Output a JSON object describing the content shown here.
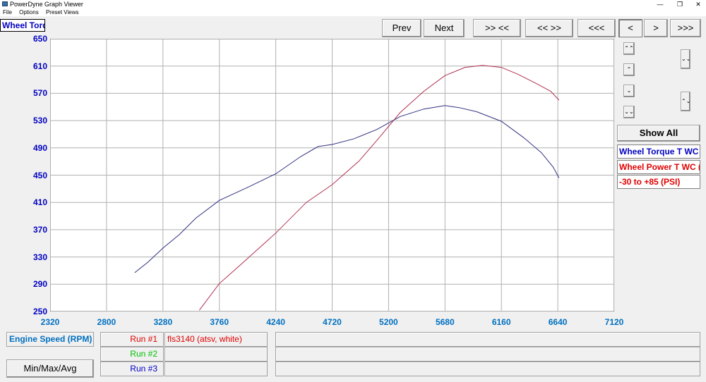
{
  "window": {
    "title": "PowerDyne Graph Viewer",
    "minimize_glyph": "—",
    "restore_glyph": "❐",
    "close_glyph": "✕"
  },
  "menu": {
    "items": [
      "File",
      "Options",
      "Preset Views"
    ]
  },
  "toolbar": {
    "prev": "Prev",
    "next": "Next",
    "zoom_in": ">> <<",
    "zoom_out": "<< >>",
    "nav_first": "<<<",
    "nav_prev": "<",
    "nav_next": ">",
    "nav_last": ">>>"
  },
  "side": {
    "show_all": "Show All",
    "small_buttons": [
      "⌃⌃",
      "⌃",
      "⌄",
      "⌄⌄",
      "⌄⌄",
      "⌃⌄"
    ]
  },
  "axis": {
    "y_title": "Wheel Torq",
    "x_title": "Engine Speed (RPM)"
  },
  "legend": [
    {
      "label": "Wheel Torque T WC",
      "color": "#0000c0"
    },
    {
      "label": "Wheel Power T WC (",
      "color": "#e00000"
    },
    {
      "label": "-30 to +85 (PSI)",
      "color": "#e00000"
    }
  ],
  "runs": [
    {
      "label": "Run #1",
      "color": "#e00000",
      "name": "fls3140 (atsv, white)"
    },
    {
      "label": "Run #2",
      "color": "#00c000",
      "name": ""
    },
    {
      "label": "Run #3",
      "color": "#0000c0",
      "name": ""
    }
  ],
  "footer": {
    "minmax": "Min/Max/Avg"
  },
  "chart_data": {
    "type": "line",
    "xlabel": "Engine Speed (RPM)",
    "ylabel": "Wheel Torq",
    "xlim": [
      2320,
      7120
    ],
    "ylim": [
      250,
      650
    ],
    "x_ticks": [
      2320,
      2800,
      3280,
      3760,
      4240,
      4720,
      5200,
      5680,
      6160,
      6640,
      7120
    ],
    "y_ticks": [
      250,
      290,
      330,
      370,
      410,
      450,
      490,
      530,
      570,
      610,
      650
    ],
    "grid": true,
    "series": [
      {
        "name": "Wheel Torque T WC",
        "color": "#303080",
        "x": [
          3040,
          3150,
          3280,
          3420,
          3560,
          3760,
          4000,
          4240,
          4450,
          4600,
          4720,
          4900,
          5100,
          5300,
          5500,
          5680,
          5800,
          5950,
          6160,
          6350,
          6500,
          6600,
          6650
        ],
        "y": [
          307,
          322,
          343,
          363,
          387,
          413,
          432,
          452,
          477,
          492,
          495,
          503,
          517,
          536,
          547,
          552,
          549,
          543,
          529,
          505,
          483,
          462,
          446
        ]
      },
      {
        "name": "Wheel Power T WC",
        "color": "#b03050",
        "x": [
          3590,
          3760,
          3950,
          4240,
          4500,
          4720,
          4950,
          5100,
          5300,
          5500,
          5680,
          5850,
          6000,
          6160,
          6300,
          6450,
          6580,
          6650
        ],
        "y": [
          252,
          291,
          320,
          365,
          410,
          436,
          471,
          501,
          542,
          573,
          596,
          608,
          611,
          608,
          598,
          585,
          573,
          560
        ]
      }
    ]
  }
}
